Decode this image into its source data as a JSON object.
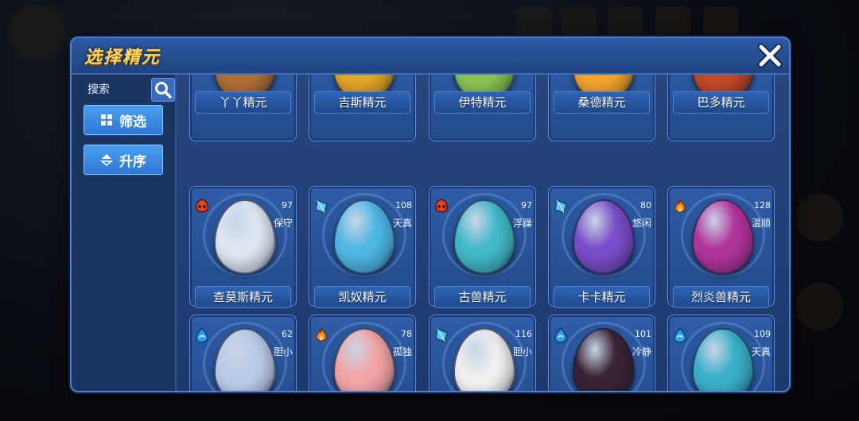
{
  "dialog": {
    "title": "选择精元"
  },
  "sidebar": {
    "search_label": "搜索",
    "filter_label": "筛选",
    "sort_label": "升序"
  },
  "row1": [
    {
      "name": "丫丫精元",
      "egg_color": "#b0703a"
    },
    {
      "name": "吉斯精元",
      "egg_color": "#e1a62a"
    },
    {
      "name": "伊特精元",
      "egg_color": "#8cc354"
    },
    {
      "name": "桑德精元",
      "egg_color": "#f2a52e"
    },
    {
      "name": "巴多精元",
      "egg_color": "#c24a2a"
    }
  ],
  "row2": [
    {
      "name": "查莫斯精元",
      "level": "97",
      "nature": "保守",
      "element": "dark-element-icon",
      "egg_color": "#dfe6f2"
    },
    {
      "name": "凯奴精元",
      "level": "108",
      "nature": "天真",
      "element": "ice-element-icon",
      "egg_color": "#4fb7e4"
    },
    {
      "name": "古兽精元",
      "level": "97",
      "nature": "浮躁",
      "element": "dark-element-icon",
      "egg_color": "#43b9c9"
    },
    {
      "name": "卡卡精元",
      "level": "80",
      "nature": "悠闲",
      "element": "ice-element-icon",
      "egg_color": "#7a4ec9"
    },
    {
      "name": "烈炎兽精元",
      "level": "128",
      "nature": "温顺",
      "element": "fire-element-icon",
      "egg_color": "#b1359c"
    }
  ],
  "row3": [
    {
      "level": "62",
      "nature": "胆小",
      "element": "water-element-icon",
      "egg_color": "#b9cbe6"
    },
    {
      "level": "78",
      "nature": "孤独",
      "element": "fire-element-icon",
      "egg_color": "#f2a5a5"
    },
    {
      "level": "116",
      "nature": "胆小",
      "element": "ice-element-icon",
      "egg_color": "#f2f0f0"
    },
    {
      "level": "101",
      "nature": "冷静",
      "element": "water-element-icon",
      "egg_color": "#3a2434"
    },
    {
      "level": "109",
      "nature": "天真",
      "element": "water-element-icon",
      "egg_color": "#3bb0c9"
    }
  ]
}
